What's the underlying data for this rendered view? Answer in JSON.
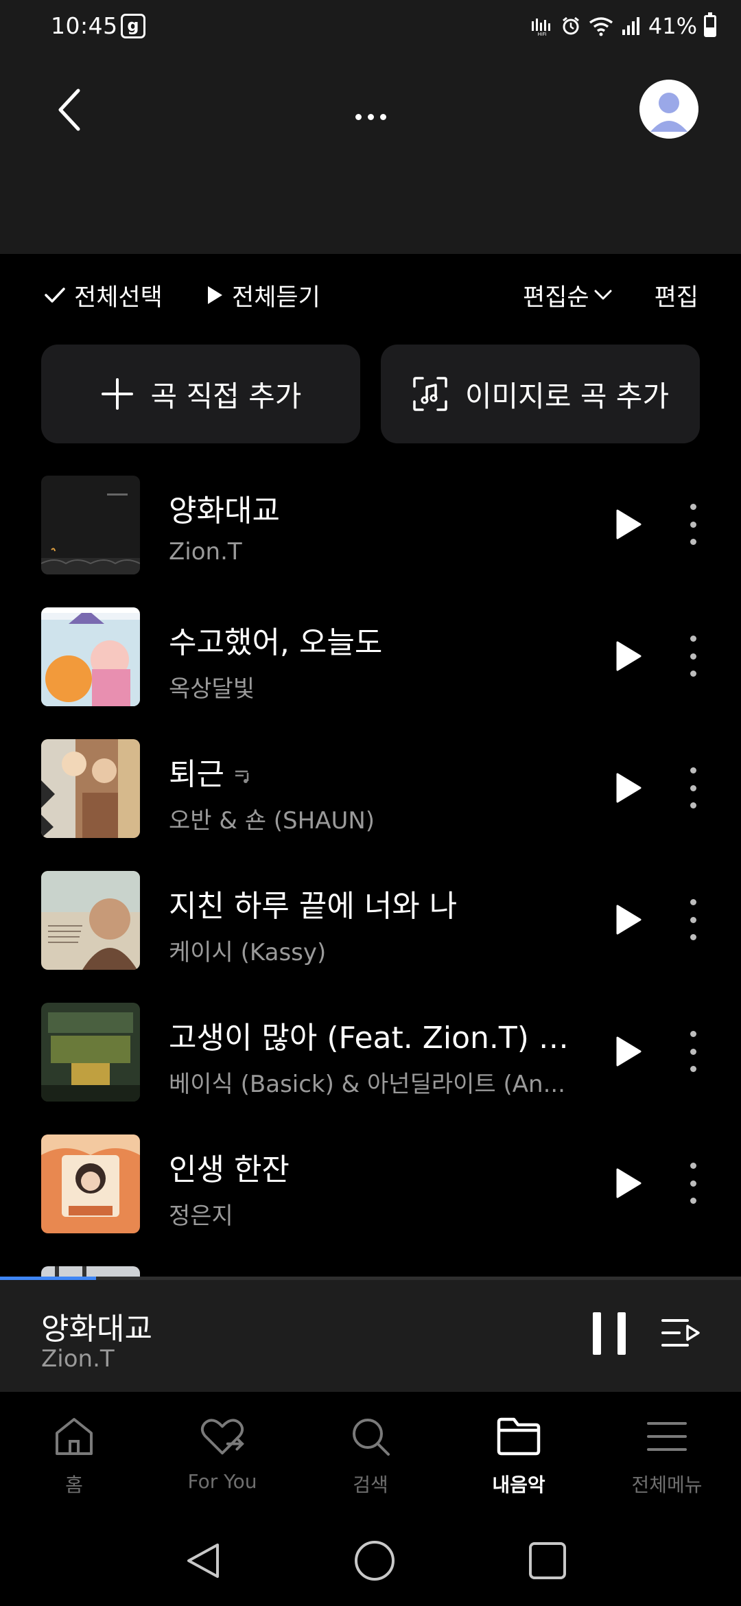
{
  "status_bar": {
    "time": "10:45",
    "notif_icon": "g",
    "battery": "41%",
    "icons": [
      "hifi-icon",
      "alarm-icon",
      "wifi-icon",
      "signal-icon",
      "battery-icon"
    ]
  },
  "header": {
    "icons": [
      "back-icon",
      "more-icon",
      "avatar-icon"
    ]
  },
  "toolbar": {
    "select_all": "전체선택",
    "play_all": "전체듣기",
    "sort": "편집순",
    "edit": "편집"
  },
  "add_buttons": {
    "direct": "곡 직접 추가",
    "image": "이미지로 곡 추가"
  },
  "songs": [
    {
      "title": "양화대교",
      "artist": "Zion.T",
      "lyrics_icon": false
    },
    {
      "title": "수고했어, 오늘도",
      "artist": "옥상달빛",
      "lyrics_icon": false
    },
    {
      "title": "퇴근",
      "artist": "오반 & 숀 (SHAUN)",
      "lyrics_icon": true
    },
    {
      "title": "지친 하루 끝에 너와 나",
      "artist": "케이시 (Kassy)",
      "lyrics_icon": false
    },
    {
      "title": "고생이 많아 (Feat. Zion.T) (P..",
      "artist": "베이식 (Basick) & 아넌딜라이트 (An...",
      "lyrics_icon": false
    },
    {
      "title": "인생 한잔",
      "artist": "정은지",
      "lyrics_icon": false
    }
  ],
  "now_playing": {
    "title": "양화대교",
    "artist": "Zion.T",
    "progress": 0.13
  },
  "bottom_nav": {
    "items": [
      {
        "label": "홈",
        "icon": "home-icon"
      },
      {
        "label": "For You",
        "icon": "heart-icon"
      },
      {
        "label": "검색",
        "icon": "search-icon"
      },
      {
        "label": "내음악",
        "icon": "folder-icon"
      },
      {
        "label": "전체메뉴",
        "icon": "menu-icon"
      }
    ],
    "active": "내음악"
  },
  "colors": {
    "background": "#000000",
    "header": "#1b1b1b",
    "accent": "#3f86f5",
    "subtext": "#9a9a9a"
  }
}
